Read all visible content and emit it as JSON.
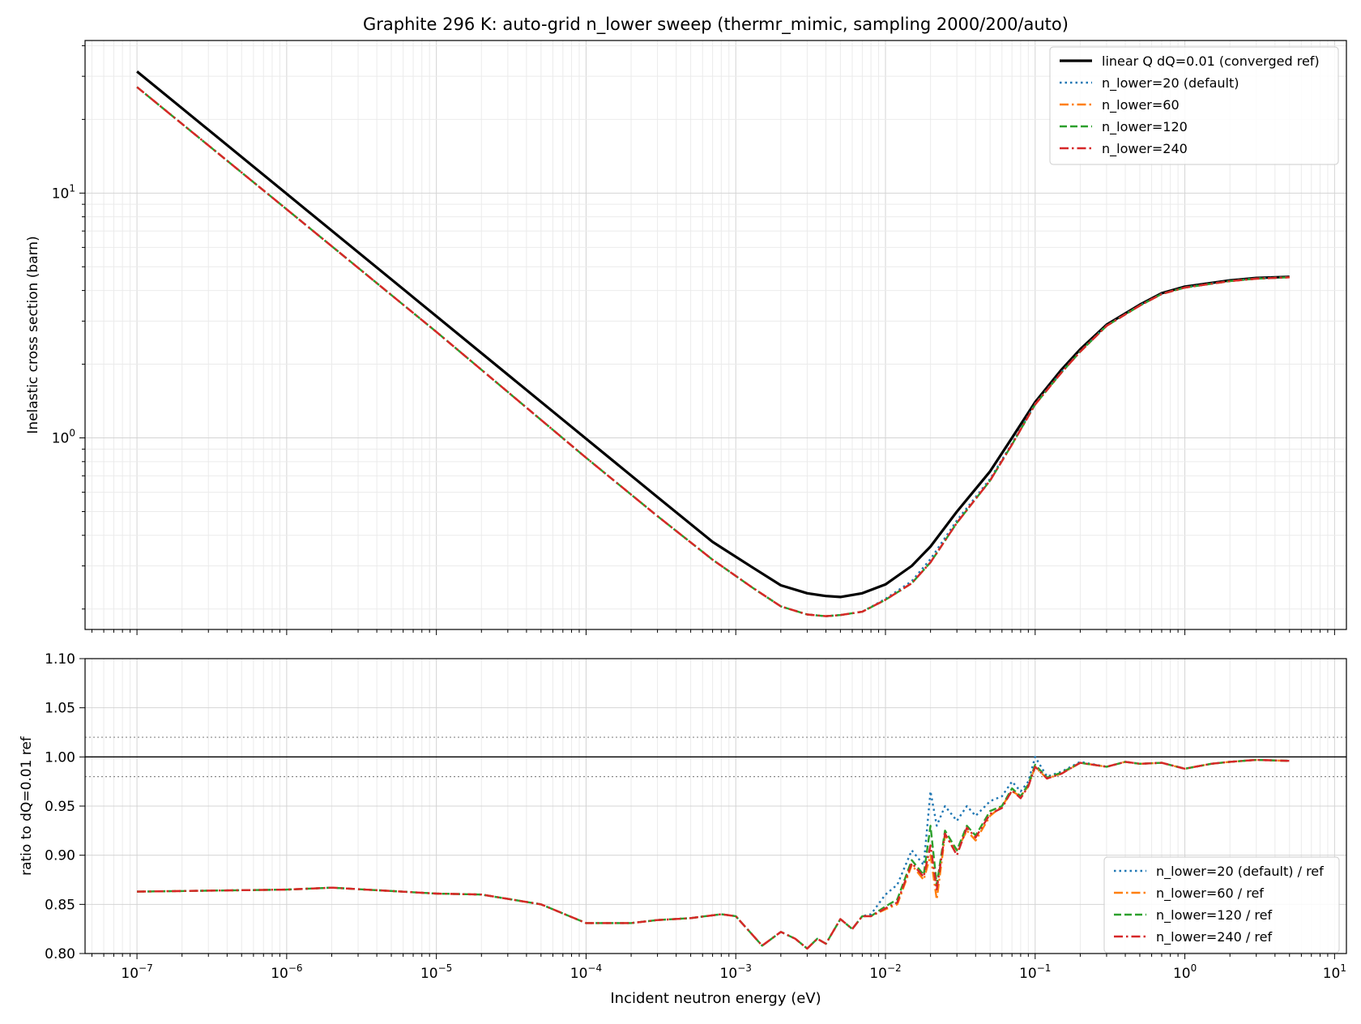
{
  "chart_data": [
    {
      "type": "line",
      "title": "Graphite 296 K: auto-grid n_lower sweep (thermr_mimic, sampling 2000/200/auto)",
      "xlabel": "",
      "ylabel": "Inelastic cross section (barn)",
      "xscale": "log",
      "yscale": "log",
      "xlim": [
        4.5e-08,
        12
      ],
      "ylim": [
        0.165,
        42
      ],
      "grid": true,
      "legend_position": "upper right",
      "yticks": [
        {
          "value": 10,
          "base": "10",
          "exp": "1"
        },
        {
          "value": 1,
          "base": "10",
          "exp": "0"
        }
      ],
      "series": [
        {
          "name": "linear Q dQ=0.01 (converged ref)",
          "color": "#000000",
          "style": "solid",
          "x": [
            1e-07,
            1e-06,
            1e-05,
            0.0001,
            0.0003,
            0.0007,
            0.0013,
            0.002,
            0.003,
            0.004,
            0.005,
            0.007,
            0.01,
            0.015,
            0.02,
            0.03,
            0.05,
            0.07,
            0.1,
            0.15,
            0.2,
            0.3,
            0.5,
            0.7,
            1,
            2,
            3,
            5
          ],
          "y": [
            31.4,
            9.93,
            3.14,
            0.993,
            0.573,
            0.376,
            0.295,
            0.25,
            0.232,
            0.226,
            0.224,
            0.232,
            0.252,
            0.3,
            0.36,
            0.5,
            0.73,
            1.0,
            1.4,
            1.9,
            2.3,
            2.9,
            3.5,
            3.9,
            4.15,
            4.4,
            4.5,
            4.55
          ]
        },
        {
          "name": "n_lower=20 (default)",
          "color": "#1f77b4",
          "style": "dotted",
          "x": [
            1e-07,
            1e-06,
            1e-05,
            0.0001,
            0.0003,
            0.0007,
            0.0013,
            0.002,
            0.003,
            0.004,
            0.005,
            0.007,
            0.01,
            0.015,
            0.02,
            0.03,
            0.05,
            0.07,
            0.1,
            0.15,
            0.2,
            0.3,
            0.5,
            0.7,
            1,
            2,
            3,
            5
          ],
          "y": [
            27.1,
            8.58,
            2.71,
            0.83,
            0.479,
            0.318,
            0.244,
            0.205,
            0.19,
            0.187,
            0.189,
            0.195,
            0.22,
            0.26,
            0.32,
            0.46,
            0.68,
            0.95,
            1.38,
            1.86,
            2.26,
            2.88,
            3.48,
            3.88,
            4.12,
            4.38,
            4.48,
            4.54
          ]
        },
        {
          "name": "n_lower=60",
          "color": "#ff7f0e",
          "style": "dashdot",
          "x": [
            1e-07,
            1e-06,
            1e-05,
            0.0001,
            0.0003,
            0.0007,
            0.0013,
            0.002,
            0.003,
            0.004,
            0.005,
            0.007,
            0.01,
            0.015,
            0.02,
            0.03,
            0.05,
            0.07,
            0.1,
            0.15,
            0.2,
            0.3,
            0.5,
            0.7,
            1,
            2,
            3,
            5
          ],
          "y": [
            27.1,
            8.58,
            2.71,
            0.83,
            0.479,
            0.318,
            0.244,
            0.205,
            0.19,
            0.187,
            0.189,
            0.195,
            0.218,
            0.255,
            0.31,
            0.45,
            0.67,
            0.94,
            1.37,
            1.85,
            2.25,
            2.87,
            3.47,
            3.87,
            4.11,
            4.37,
            4.47,
            4.53
          ]
        },
        {
          "name": "n_lower=120",
          "color": "#2ca02c",
          "style": "dashed",
          "x": [
            1e-07,
            1e-06,
            1e-05,
            0.0001,
            0.0003,
            0.0007,
            0.0013,
            0.002,
            0.003,
            0.004,
            0.005,
            0.007,
            0.01,
            0.015,
            0.02,
            0.03,
            0.05,
            0.07,
            0.1,
            0.15,
            0.2,
            0.3,
            0.5,
            0.7,
            1,
            2,
            3,
            5
          ],
          "y": [
            27.1,
            8.58,
            2.71,
            0.83,
            0.479,
            0.318,
            0.244,
            0.205,
            0.19,
            0.187,
            0.189,
            0.195,
            0.218,
            0.255,
            0.31,
            0.45,
            0.67,
            0.94,
            1.37,
            1.85,
            2.25,
            2.87,
            3.47,
            3.87,
            4.11,
            4.37,
            4.47,
            4.53
          ]
        },
        {
          "name": "n_lower=240",
          "color": "#d62728",
          "style": "dashdot",
          "x": [
            1e-07,
            1e-06,
            1e-05,
            0.0001,
            0.0003,
            0.0007,
            0.0013,
            0.002,
            0.003,
            0.004,
            0.005,
            0.007,
            0.01,
            0.015,
            0.02,
            0.03,
            0.05,
            0.07,
            0.1,
            0.15,
            0.2,
            0.3,
            0.5,
            0.7,
            1,
            2,
            3,
            5
          ],
          "y": [
            27.1,
            8.58,
            2.71,
            0.83,
            0.479,
            0.318,
            0.244,
            0.205,
            0.19,
            0.187,
            0.189,
            0.195,
            0.218,
            0.255,
            0.31,
            0.45,
            0.67,
            0.94,
            1.37,
            1.85,
            2.25,
            2.87,
            3.47,
            3.87,
            4.11,
            4.37,
            4.47,
            4.53
          ]
        }
      ]
    },
    {
      "type": "line",
      "title": "",
      "xlabel": "Incident neutron energy (eV)",
      "ylabel": "ratio to dQ=0.01 ref",
      "xscale": "log",
      "yscale": "linear",
      "xlim": [
        4.5e-08,
        12
      ],
      "ylim": [
        0.8,
        1.1
      ],
      "grid": true,
      "legend_position": "lower right",
      "xticks": [
        {
          "value": 1e-07,
          "base": "10",
          "exp": "−7"
        },
        {
          "value": 1e-06,
          "base": "10",
          "exp": "−6"
        },
        {
          "value": 1e-05,
          "base": "10",
          "exp": "−5"
        },
        {
          "value": 0.0001,
          "base": "10",
          "exp": "−4"
        },
        {
          "value": 0.001,
          "base": "10",
          "exp": "−3"
        },
        {
          "value": 0.01,
          "base": "10",
          "exp": "−2"
        },
        {
          "value": 0.1,
          "base": "10",
          "exp": "−1"
        },
        {
          "value": 1,
          "base": "10",
          "exp": "0"
        },
        {
          "value": 10,
          "base": "10",
          "exp": "1"
        }
      ],
      "yticks": [
        {
          "value": 0.8,
          "label": "0.80"
        },
        {
          "value": 0.85,
          "label": "0.85"
        },
        {
          "value": 0.9,
          "label": "0.90"
        },
        {
          "value": 0.95,
          "label": "0.95"
        },
        {
          "value": 1.0,
          "label": "1.00"
        },
        {
          "value": 1.05,
          "label": "1.05"
        },
        {
          "value": 1.1,
          "label": "1.10"
        }
      ],
      "reference_lines": [
        {
          "y": 1.0,
          "color": "#000000",
          "style": "solid"
        },
        {
          "y": 1.02,
          "color": "#888888",
          "style": "dotted"
        },
        {
          "y": 0.98,
          "color": "#888888",
          "style": "dotted"
        }
      ],
      "series": [
        {
          "name": "n_lower=20 (default) / ref",
          "color": "#1f77b4",
          "style": "dotted",
          "x": [
            1e-07,
            1e-06,
            2e-06,
            1e-05,
            2e-05,
            5e-05,
            0.0001,
            0.0002,
            0.0003,
            0.0005,
            0.0008,
            0.001,
            0.0015,
            0.002,
            0.0025,
            0.003,
            0.0035,
            0.004,
            0.005,
            0.006,
            0.007,
            0.008,
            0.01,
            0.012,
            0.015,
            0.018,
            0.02,
            0.022,
            0.025,
            0.03,
            0.035,
            0.04,
            0.05,
            0.06,
            0.07,
            0.08,
            0.09,
            0.1,
            0.12,
            0.15,
            0.2,
            0.3,
            0.4,
            0.5,
            0.7,
            1,
            1.5,
            2,
            3,
            5
          ],
          "y": [
            0.863,
            0.865,
            0.867,
            0.861,
            0.86,
            0.85,
            0.831,
            0.831,
            0.834,
            0.836,
            0.84,
            0.838,
            0.808,
            0.822,
            0.815,
            0.805,
            0.815,
            0.81,
            0.835,
            0.825,
            0.838,
            0.84,
            0.86,
            0.87,
            0.905,
            0.89,
            0.965,
            0.93,
            0.95,
            0.935,
            0.95,
            0.94,
            0.955,
            0.96,
            0.975,
            0.965,
            0.975,
            1.0,
            0.98,
            0.985,
            0.995,
            0.99,
            0.995,
            0.993,
            0.994,
            0.988,
            0.993,
            0.995,
            0.997,
            0.996
          ]
        },
        {
          "name": "n_lower=60 / ref",
          "color": "#ff7f0e",
          "style": "dashdot",
          "x": [
            1e-07,
            1e-06,
            2e-06,
            1e-05,
            2e-05,
            5e-05,
            0.0001,
            0.0002,
            0.0003,
            0.0005,
            0.0008,
            0.001,
            0.0015,
            0.002,
            0.0025,
            0.003,
            0.0035,
            0.004,
            0.005,
            0.006,
            0.007,
            0.008,
            0.01,
            0.012,
            0.015,
            0.018,
            0.02,
            0.022,
            0.025,
            0.03,
            0.035,
            0.04,
            0.05,
            0.06,
            0.07,
            0.08,
            0.09,
            0.1,
            0.12,
            0.15,
            0.2,
            0.3,
            0.4,
            0.5,
            0.7,
            1,
            1.5,
            2,
            3,
            5
          ],
          "y": [
            0.863,
            0.865,
            0.867,
            0.861,
            0.86,
            0.85,
            0.831,
            0.831,
            0.834,
            0.836,
            0.84,
            0.838,
            0.808,
            0.822,
            0.815,
            0.805,
            0.815,
            0.81,
            0.835,
            0.825,
            0.838,
            0.838,
            0.845,
            0.85,
            0.89,
            0.875,
            0.9,
            0.855,
            0.92,
            0.905,
            0.925,
            0.915,
            0.94,
            0.95,
            0.965,
            0.96,
            0.97,
            0.99,
            0.978,
            0.983,
            0.994,
            0.99,
            0.995,
            0.993,
            0.994,
            0.988,
            0.993,
            0.995,
            0.997,
            0.996
          ]
        },
        {
          "name": "n_lower=120 / ref",
          "color": "#2ca02c",
          "style": "dashed",
          "x": [
            1e-07,
            1e-06,
            2e-06,
            1e-05,
            2e-05,
            5e-05,
            0.0001,
            0.0002,
            0.0003,
            0.0005,
            0.0008,
            0.001,
            0.0015,
            0.002,
            0.0025,
            0.003,
            0.0035,
            0.004,
            0.005,
            0.006,
            0.007,
            0.008,
            0.01,
            0.012,
            0.015,
            0.018,
            0.02,
            0.022,
            0.025,
            0.03,
            0.035,
            0.04,
            0.05,
            0.06,
            0.07,
            0.08,
            0.09,
            0.1,
            0.12,
            0.15,
            0.2,
            0.3,
            0.4,
            0.5,
            0.7,
            1,
            1.5,
            2,
            3,
            5
          ],
          "y": [
            0.863,
            0.865,
            0.867,
            0.861,
            0.86,
            0.85,
            0.831,
            0.831,
            0.834,
            0.836,
            0.84,
            0.838,
            0.808,
            0.822,
            0.815,
            0.805,
            0.815,
            0.81,
            0.835,
            0.825,
            0.838,
            0.838,
            0.848,
            0.855,
            0.895,
            0.88,
            0.93,
            0.87,
            0.925,
            0.905,
            0.93,
            0.92,
            0.945,
            0.95,
            0.968,
            0.96,
            0.972,
            0.992,
            0.979,
            0.984,
            0.994,
            0.99,
            0.995,
            0.993,
            0.994,
            0.988,
            0.993,
            0.995,
            0.997,
            0.996
          ]
        },
        {
          "name": "n_lower=240 / ref",
          "color": "#d62728",
          "style": "dashdot",
          "x": [
            1e-07,
            1e-06,
            2e-06,
            1e-05,
            2e-05,
            5e-05,
            0.0001,
            0.0002,
            0.0003,
            0.0005,
            0.0008,
            0.001,
            0.0015,
            0.002,
            0.0025,
            0.003,
            0.0035,
            0.004,
            0.005,
            0.006,
            0.007,
            0.008,
            0.01,
            0.012,
            0.015,
            0.018,
            0.02,
            0.022,
            0.025,
            0.03,
            0.035,
            0.04,
            0.05,
            0.06,
            0.07,
            0.08,
            0.09,
            0.1,
            0.12,
            0.15,
            0.2,
            0.3,
            0.4,
            0.5,
            0.7,
            1,
            1.5,
            2,
            3,
            5
          ],
          "y": [
            0.863,
            0.865,
            0.867,
            0.861,
            0.86,
            0.85,
            0.831,
            0.831,
            0.834,
            0.836,
            0.84,
            0.838,
            0.808,
            0.822,
            0.815,
            0.805,
            0.815,
            0.81,
            0.835,
            0.825,
            0.838,
            0.838,
            0.846,
            0.852,
            0.892,
            0.878,
            0.91,
            0.865,
            0.922,
            0.9,
            0.928,
            0.918,
            0.942,
            0.948,
            0.966,
            0.958,
            0.97,
            0.99,
            0.978,
            0.983,
            0.994,
            0.99,
            0.995,
            0.993,
            0.994,
            0.988,
            0.993,
            0.995,
            0.997,
            0.996
          ]
        }
      ]
    }
  ]
}
